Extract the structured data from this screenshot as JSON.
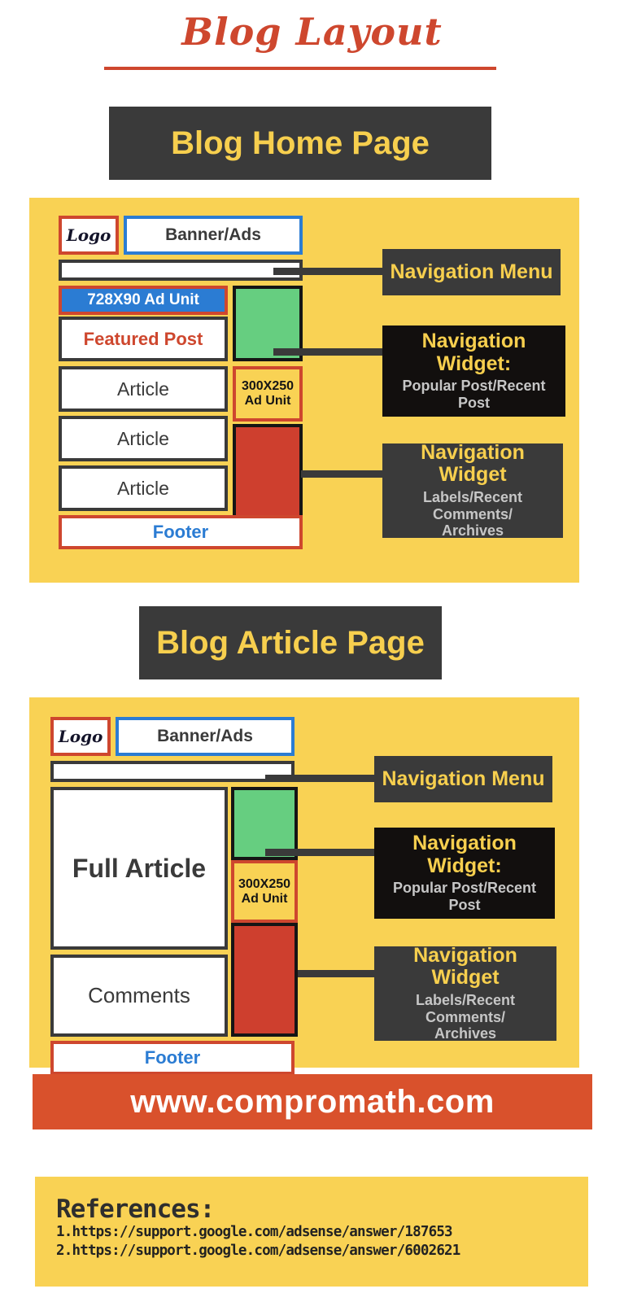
{
  "title": "Blog Layout",
  "sections": [
    {
      "header": "Blog Home Page",
      "mockup": {
        "logo": "Logo",
        "banner": "Banner/Ads",
        "nav_bar": "",
        "ad_728x90": "728X90 Ad Unit",
        "featured_post": "Featured Post",
        "articles": [
          "Article",
          "Article",
          "Article"
        ],
        "ad_300x250_line1": "300X250",
        "ad_300x250_line2": "Ad Unit",
        "footer": "Footer"
      },
      "callouts": [
        {
          "title": "Navigation Menu",
          "sub": ""
        },
        {
          "title": "Navigation Widget:",
          "sub": "Popular Post/Recent Post"
        },
        {
          "title": "Navigation Widget",
          "sub": "Labels/Recent Comments/\nArchives"
        }
      ]
    },
    {
      "header": "Blog Article Page",
      "mockup": {
        "logo": "Logo",
        "banner": "Banner/Ads",
        "nav_bar": "",
        "full_article": "Full Article",
        "ad_300x250_line1": "300X250",
        "ad_300x250_line2": "Ad Unit",
        "comments": "Comments",
        "footer": "Footer"
      },
      "callouts": [
        {
          "title": "Navigation Menu",
          "sub": ""
        },
        {
          "title": "Navigation Widget:",
          "sub": "Popular Post/Recent Post"
        },
        {
          "title": "Navigation Widget",
          "sub": "Labels/Recent Comments/\nArchives"
        }
      ]
    }
  ],
  "website": "www.compromath.com",
  "references": {
    "heading": "References:",
    "items": [
      "1.https://support.google.com/adsense/answer/187653",
      "2.https://support.google.com/adsense/answer/6002621"
    ]
  },
  "colors": {
    "accent_red": "#CE472E",
    "panel_yellow": "#F9D254",
    "header_dark": "#3A3A3A",
    "header_text_yellow": "#F7CF4E",
    "ad_blue": "#2B7CD3",
    "widget_green": "#66CE80",
    "widget_red": "#CE3F2E",
    "site_bar_red": "#D9512C"
  }
}
